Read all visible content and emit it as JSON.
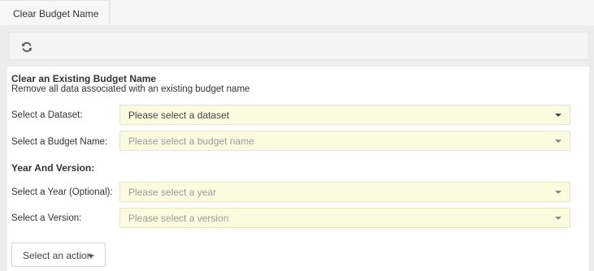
{
  "tabs": [
    {
      "label": "Clear Budget Name",
      "active": true
    }
  ],
  "toolbar": {
    "refresh_icon": "refresh-icon"
  },
  "form": {
    "title": "Clear an Existing Budget Name",
    "subtitle": "Remove all data associated with an existing budget name",
    "dataset": {
      "label": "Select a Dataset:",
      "placeholder": "Please select a dataset"
    },
    "budget_name": {
      "label": "Select a Budget Name:",
      "placeholder": "Please select a budget name"
    },
    "year_version_heading": "Year And Version:",
    "year": {
      "label": "Select a Year (Optional):",
      "placeholder": "Please select a year"
    },
    "version": {
      "label": "Select a Version:",
      "placeholder": "Please select a version"
    },
    "action_button": "Select an action"
  },
  "colors": {
    "select_background": "#fbfbe0",
    "panel_background": "#ececec",
    "content_background": "#ffffff"
  }
}
